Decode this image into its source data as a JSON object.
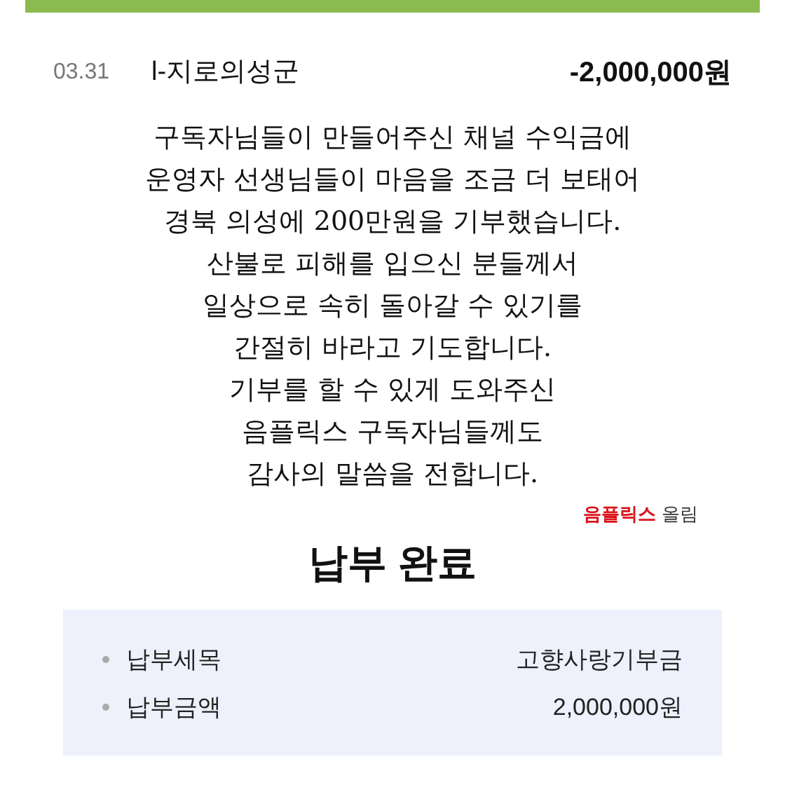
{
  "transaction": {
    "date": "03.31",
    "payee": "l-지로의성군",
    "amount": "-2,000,000원"
  },
  "message": {
    "lines": [
      "구독자님들이 만들어주신 채널 수익금에",
      "운영자 선생님들이 마음을 조금 더 보태어",
      "경북 의성에 200만원을 기부했습니다.",
      "산불로 피해를 입으신 분들께서",
      "일상으로 속히 돌아갈 수 있기를",
      "간절히 바라고 기도합니다.",
      "기부를 할 수 있게 도와주신",
      "음플릭스 구독자님들께도",
      "감사의 말씀을 전합니다."
    ],
    "signature_brand": "음플릭스",
    "signature_suffix": "올림"
  },
  "receipt": {
    "title": "납부 완료",
    "items": [
      {
        "label": "납부세목",
        "value": "고향사랑기부금"
      },
      {
        "label": "납부금액",
        "value": "2,000,000원"
      }
    ]
  }
}
